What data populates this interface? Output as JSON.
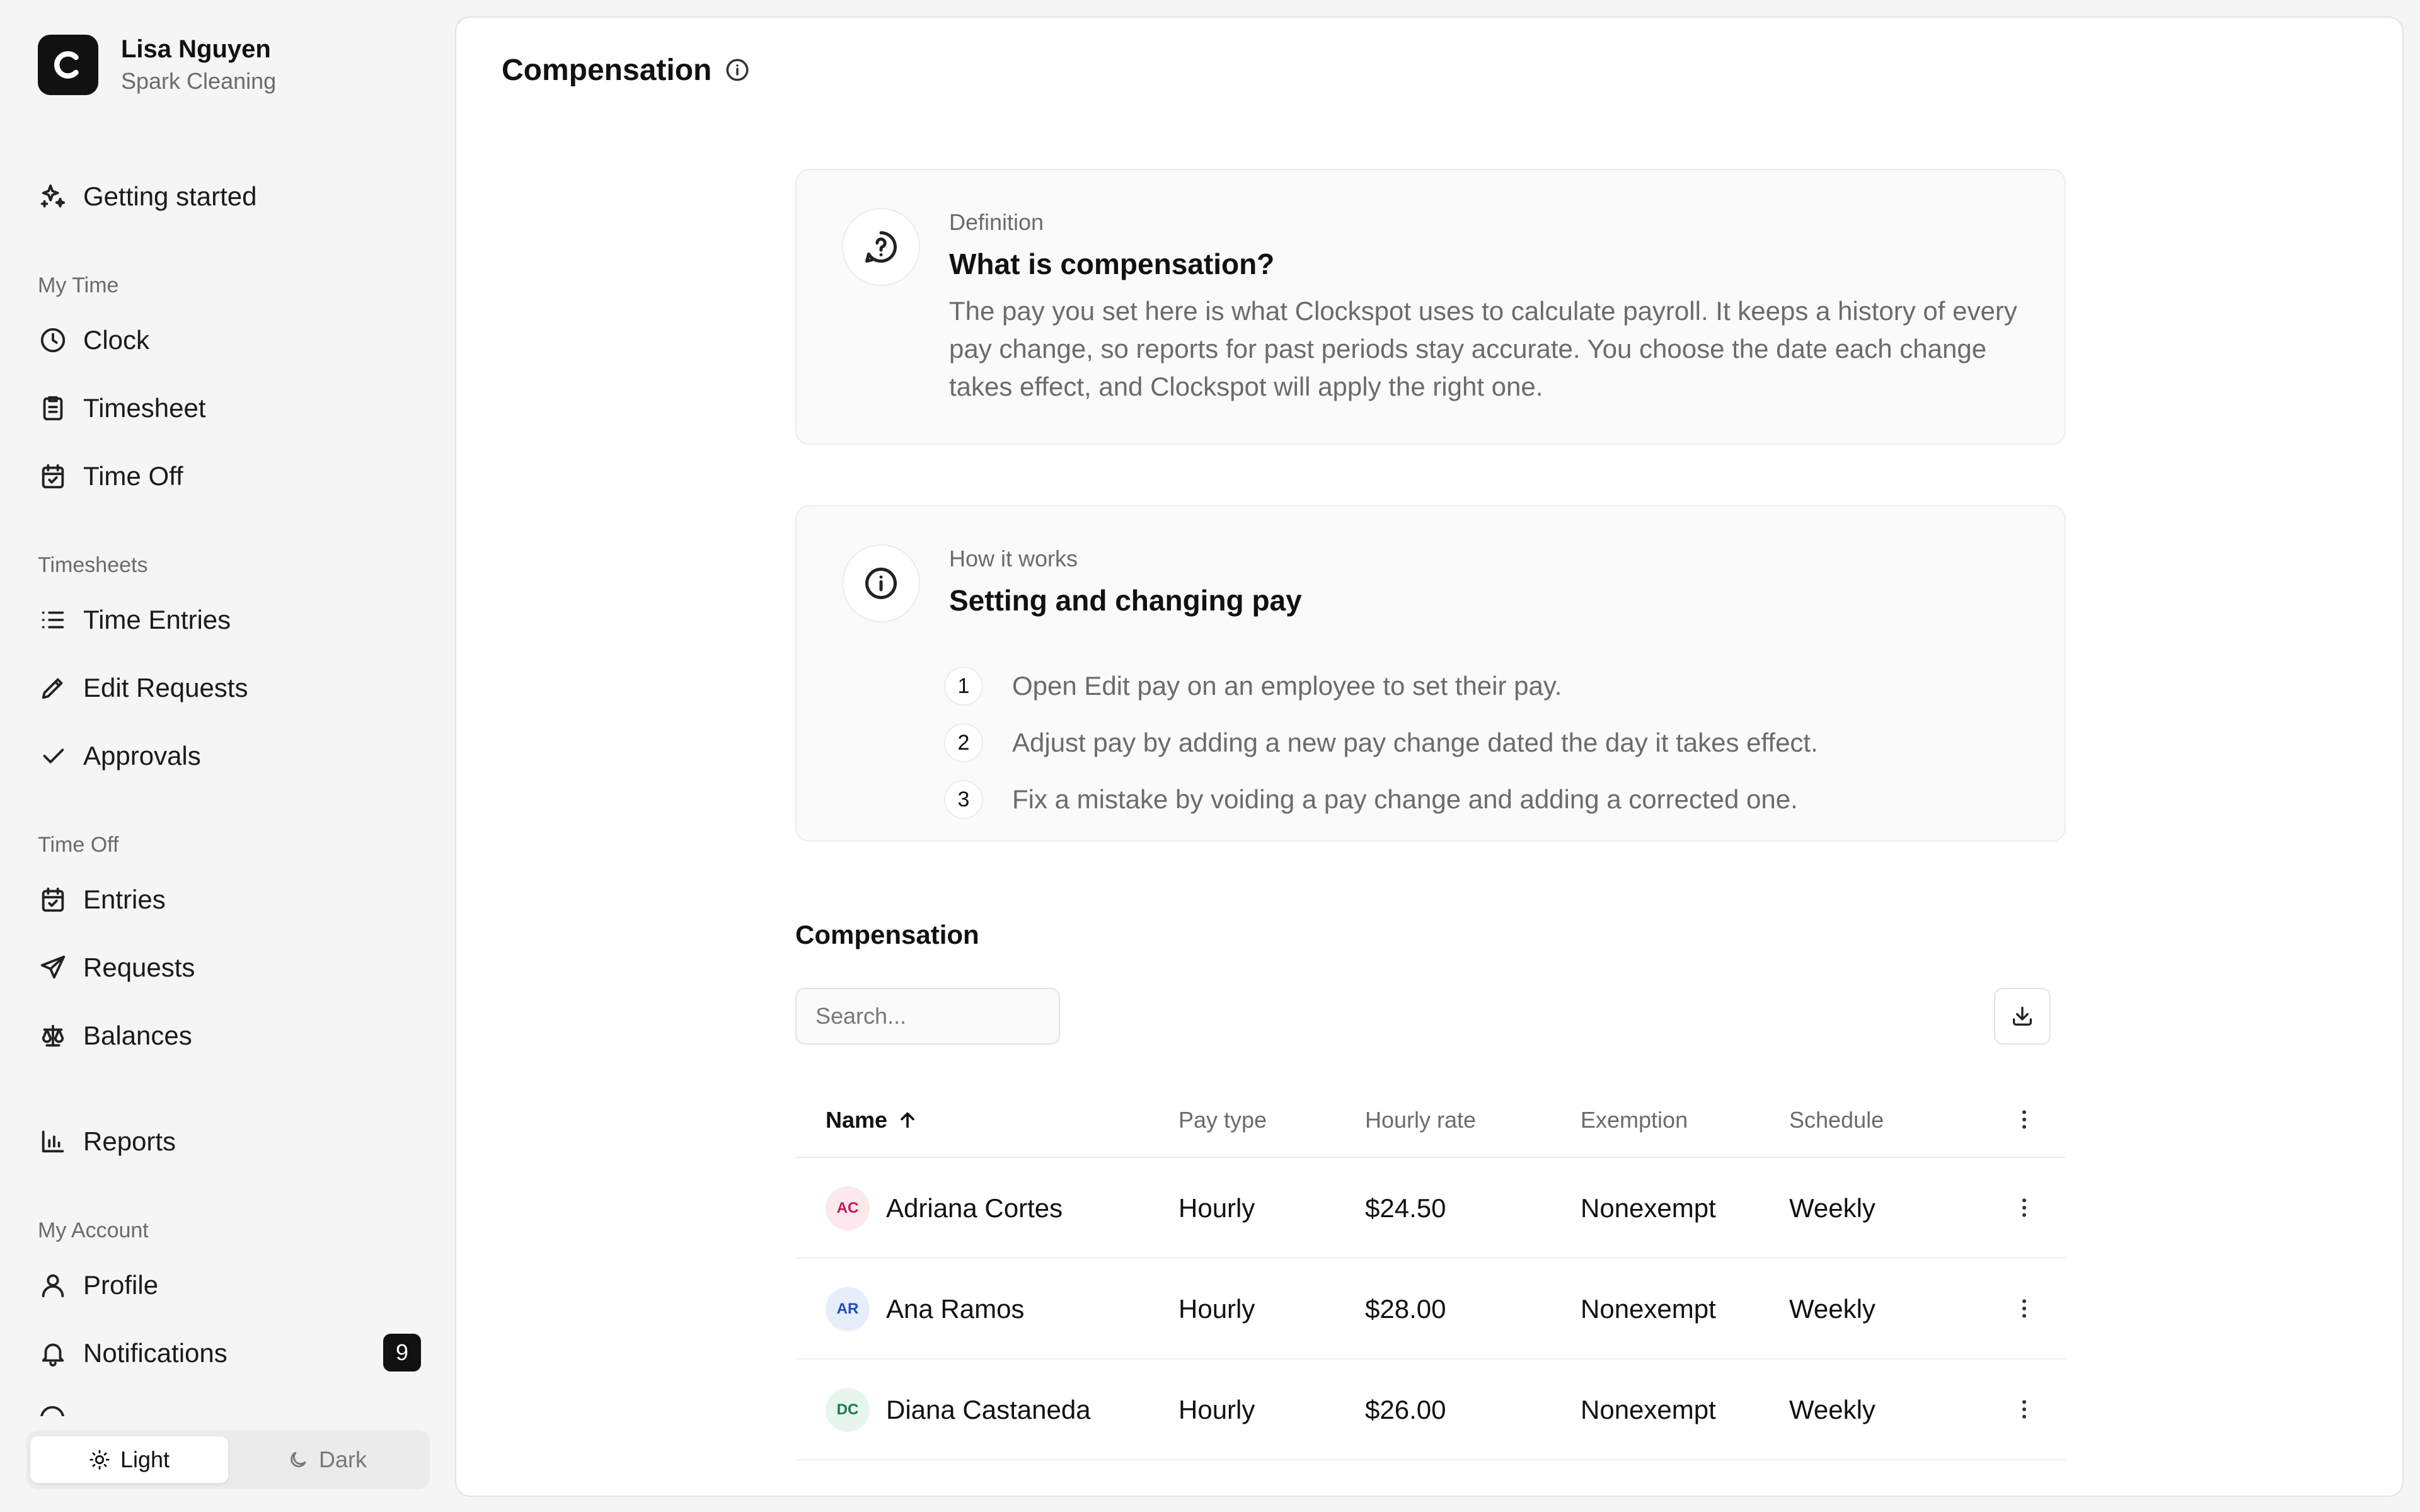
{
  "account": {
    "logo_letter": "C",
    "name": "Lisa Nguyen",
    "org": "Spark Cleaning"
  },
  "sidebar": {
    "getting_started": "Getting started",
    "sections": {
      "my_time": "My Time",
      "timesheets": "Timesheets",
      "time_off": "Time Off",
      "my_account": "My Account"
    },
    "items": {
      "clock": "Clock",
      "timesheet": "Timesheet",
      "time_off": "Time Off",
      "time_entries": "Time Entries",
      "edit_requests": "Edit Requests",
      "approvals": "Approvals",
      "entries": "Entries",
      "requests": "Requests",
      "balances": "Balances",
      "reports": "Reports",
      "profile": "Profile",
      "notifications": "Notifications"
    },
    "notifications_count": "9",
    "theme": {
      "light": "Light",
      "dark": "Dark",
      "selected": "Light"
    }
  },
  "page": {
    "title": "Compensation"
  },
  "definition_card": {
    "eyebrow": "Definition",
    "title": "What is compensation?",
    "body": "The pay you set here is what Clockspot uses to calculate payroll. It keeps a history of every pay change, so reports for past periods stay accurate. You choose the date each change takes effect, and Clockspot will apply the right one."
  },
  "how_card": {
    "eyebrow": "How it works",
    "title": "Setting and changing pay",
    "steps": [
      {
        "num": "1",
        "text": "Open Edit pay on an employee to set their pay."
      },
      {
        "num": "2",
        "text": "Adjust pay by adding a new pay change dated the day it takes effect."
      },
      {
        "num": "3",
        "text": "Fix a mistake by voiding a pay change and adding a corrected one."
      }
    ]
  },
  "table": {
    "section_title": "Compensation",
    "search_placeholder": "Search...",
    "columns": {
      "name": "Name",
      "pay_type": "Pay type",
      "hourly_rate": "Hourly rate",
      "exemption": "Exemption",
      "schedule": "Schedule"
    },
    "sort": {
      "column": "Name",
      "direction": "ascending"
    },
    "rows": [
      {
        "initials": "AC",
        "name": "Adriana Cortes",
        "pay_type": "Hourly",
        "rate": "$24.50",
        "exemption": "Nonexempt",
        "schedule": "Weekly",
        "avatar_bg": "#fde8ec",
        "avatar_fg": "#c2185b"
      },
      {
        "initials": "AR",
        "name": "Ana Ramos",
        "pay_type": "Hourly",
        "rate": "$28.00",
        "exemption": "Nonexempt",
        "schedule": "Weekly",
        "avatar_bg": "#e6eefc",
        "avatar_fg": "#1e4fb8"
      },
      {
        "initials": "DC",
        "name": "Diana Castaneda",
        "pay_type": "Hourly",
        "rate": "$26.00",
        "exemption": "Nonexempt",
        "schedule": "Weekly",
        "avatar_bg": "#e6f6ee",
        "avatar_fg": "#1b7a4a"
      }
    ]
  }
}
